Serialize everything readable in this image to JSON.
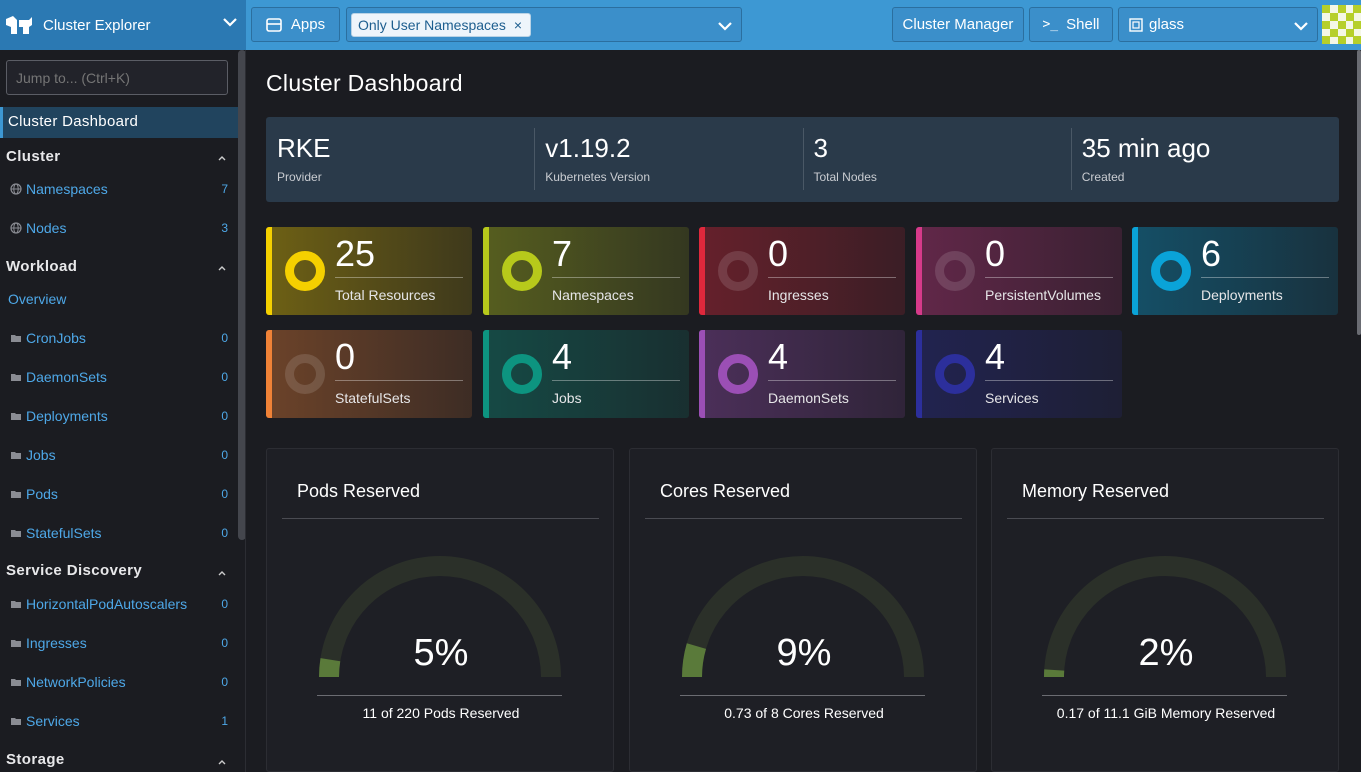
{
  "header": {
    "app_title": "Cluster Explorer",
    "apps_label": "Apps",
    "namespace_filter": "Only User Namespaces",
    "cluster_manager_label": "Cluster Manager",
    "shell_label": "Shell",
    "cluster_name": "glass"
  },
  "sidebar": {
    "jump_placeholder": "Jump to... (Ctrl+K)",
    "active_item": "Cluster Dashboard",
    "groups": [
      {
        "title": "Cluster",
        "items": [
          {
            "label": "Namespaces",
            "count": "7"
          },
          {
            "label": "Nodes",
            "count": "3"
          }
        ]
      },
      {
        "title": "Workload",
        "overview": "Overview",
        "items": [
          {
            "label": "CronJobs",
            "count": "0"
          },
          {
            "label": "DaemonSets",
            "count": "0"
          },
          {
            "label": "Deployments",
            "count": "0"
          },
          {
            "label": "Jobs",
            "count": "0"
          },
          {
            "label": "Pods",
            "count": "0"
          },
          {
            "label": "StatefulSets",
            "count": "0"
          }
        ]
      },
      {
        "title": "Service Discovery",
        "items": [
          {
            "label": "HorizontalPodAutoscalers",
            "count": "0"
          },
          {
            "label": "Ingresses",
            "count": "0"
          },
          {
            "label": "NetworkPolicies",
            "count": "0"
          },
          {
            "label": "Services",
            "count": "1"
          }
        ]
      },
      {
        "title": "Storage",
        "items": []
      }
    ]
  },
  "main": {
    "title": "Cluster Dashboard",
    "facts": [
      {
        "value": "RKE",
        "label": "Provider"
      },
      {
        "value": "v1.19.2",
        "label": "Kubernetes Version"
      },
      {
        "value": "3",
        "label": "Total Nodes"
      },
      {
        "value": "35 min ago",
        "label": "Created"
      }
    ],
    "tiles": [
      {
        "count": "25",
        "label": "Total Resources",
        "color": "#f5d000"
      },
      {
        "count": "7",
        "label": "Namespaces",
        "color": "#b7c91b"
      },
      {
        "count": "0",
        "label": "Ingresses",
        "color": "#e0283c"
      },
      {
        "count": "0",
        "label": "PersistentVolumes",
        "color": "#d63a8a"
      },
      {
        "count": "6",
        "label": "Deployments",
        "color": "#0aa3d8"
      },
      {
        "count": "0",
        "label": "StatefulSets",
        "color": "#f08237"
      },
      {
        "count": "4",
        "label": "Jobs",
        "color": "#0d9480"
      },
      {
        "count": "4",
        "label": "DaemonSets",
        "color": "#9b4fb5"
      },
      {
        "count": "4",
        "label": "Services",
        "color": "#2c2f9c"
      }
    ],
    "gauges": [
      {
        "title": "Pods Reserved",
        "percent": "5%",
        "fraction": 0.05,
        "detail": "11 of 220 Pods Reserved"
      },
      {
        "title": "Cores Reserved",
        "percent": "9%",
        "fraction": 0.09,
        "detail": "0.73 of 8 Cores Reserved"
      },
      {
        "title": "Memory Reserved",
        "percent": "2%",
        "fraction": 0.02,
        "detail": "0.17 of 11.1 GiB Memory Reserved"
      }
    ]
  }
}
